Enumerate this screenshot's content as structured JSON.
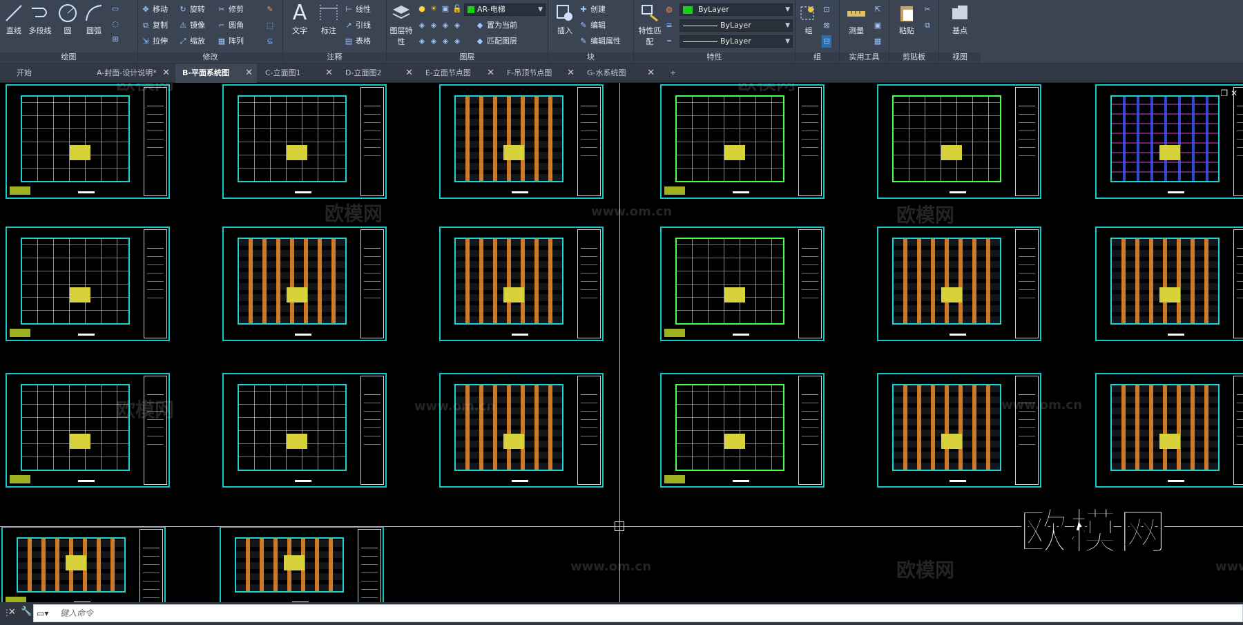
{
  "ribbon": {
    "draw": {
      "label": "绘图",
      "tools": [
        "直线",
        "多段线",
        "圆",
        "圆弧"
      ]
    },
    "modify": {
      "label": "修改",
      "tools": [
        "移动",
        "旋转",
        "修剪",
        "复制",
        "镜像",
        "圆角",
        "拉伸",
        "缩放",
        "阵列"
      ]
    },
    "annotation": {
      "label": "注释",
      "tools": [
        "文字",
        "标注",
        "线性",
        "引线",
        "表格"
      ]
    },
    "layers": {
      "label": "图层",
      "layer_props": "图层特性",
      "current_layer": "AR-电梯",
      "set_current": "置为当前",
      "match_layer": "匹配图层"
    },
    "block": {
      "label": "块",
      "insert": "插入",
      "create": "创建",
      "edit": "编辑",
      "edit_attrs": "编辑属性"
    },
    "properties": {
      "label": "特性",
      "match": "特性匹配",
      "color": "ByLayer",
      "linetype": "ByLayer",
      "lineweight": "ByLayer"
    },
    "groups": {
      "label": "组",
      "group": "组"
    },
    "utilities": {
      "label": "实用工具",
      "measure": "测量"
    },
    "clipboard": {
      "label": "剪贴板",
      "paste": "粘贴"
    },
    "view": {
      "label": "视图",
      "base": "基点"
    }
  },
  "tabs": [
    {
      "label": "开始",
      "active": false,
      "closable": false
    },
    {
      "label": "A-封面-设计说明*",
      "active": false,
      "closable": true
    },
    {
      "label": "B-平面系统图",
      "active": true,
      "closable": true
    },
    {
      "label": "C-立面图1",
      "active": false,
      "closable": true
    },
    {
      "label": "D-立面图2",
      "active": false,
      "closable": true
    },
    {
      "label": "E-立面节点图",
      "active": false,
      "closable": true
    },
    {
      "label": "F-吊顶节点图",
      "active": false,
      "closable": true
    },
    {
      "label": "G-水系统图",
      "active": false,
      "closable": true
    }
  ],
  "add_tab": "+",
  "watermarks": {
    "cn": "欧模网",
    "url": "www.om.cn"
  },
  "big_watermark": "欧模网",
  "command": {
    "placeholder": "键入命令"
  },
  "colors": {
    "ribbon": "#3b4453",
    "sheet_border": "#16c9c9",
    "canvas": "#000000"
  }
}
